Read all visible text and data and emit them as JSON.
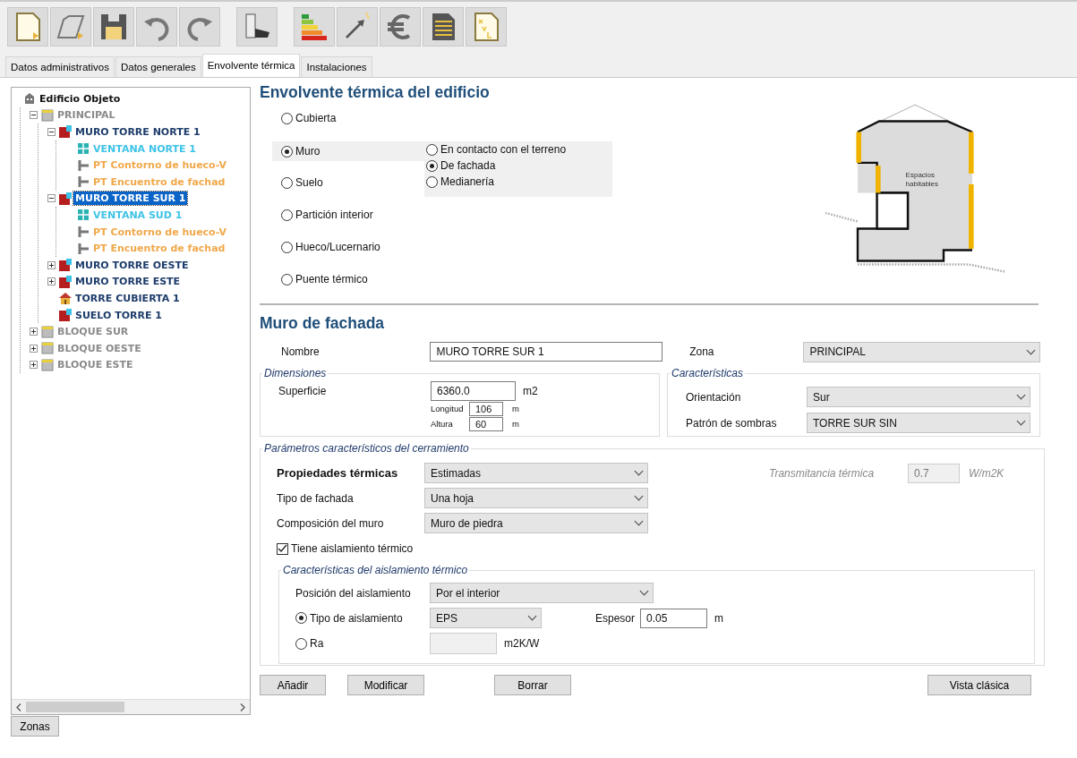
{
  "tabs": [
    {
      "label": "Datos administrativos",
      "selected": false
    },
    {
      "label": "Datos generales",
      "selected": false
    },
    {
      "label": "Envolvente térmica",
      "selected": true
    },
    {
      "label": "Instalaciones",
      "selected": false
    }
  ],
  "tree": {
    "label": "Edificio Objeto",
    "kind": "building",
    "children": [
      {
        "label": "PRINCIPAL",
        "kind": "zone",
        "selected": false,
        "expanded": true,
        "children": [
          {
            "label": "MURO TORRE  NORTE 1",
            "kind": "wall",
            "selected": false,
            "expanded": true,
            "children": [
              {
                "label": "VENTANA NORTE 1",
                "kind": "window",
                "selected": false
              },
              {
                "label": "PT Contorno de hueco-V",
                "kind": "bridge",
                "selected": false
              },
              {
                "label": "PT Encuentro de fachad",
                "kind": "bridge",
                "selected": false
              }
            ]
          },
          {
            "label": "MURO TORRE SUR 1",
            "kind": "wall",
            "selected": true,
            "expanded": true,
            "children": [
              {
                "label": "VENTANA SUD 1",
                "kind": "window",
                "selected": false
              },
              {
                "label": "PT Contorno de hueco-V",
                "kind": "bridge",
                "selected": false
              },
              {
                "label": "PT Encuentro de fachad",
                "kind": "bridge",
                "selected": false
              }
            ]
          },
          {
            "label": "MURO TORRE OESTE",
            "kind": "wall",
            "selected": false,
            "expanded": false
          },
          {
            "label": "MURO TORRE ESTE",
            "kind": "wall",
            "selected": false,
            "expanded": false
          },
          {
            "label": "TORRE CUBIERTA 1",
            "kind": "roof",
            "selected": false
          },
          {
            "label": "SUELO TORRE 1",
            "kind": "wall",
            "selected": false
          }
        ]
      },
      {
        "label": "BLOQUE SUR",
        "kind": "zone",
        "selected": false,
        "expanded": false
      },
      {
        "label": "BLOQUE OESTE",
        "kind": "zone",
        "selected": false,
        "expanded": false
      },
      {
        "label": "BLOQUE ESTE",
        "kind": "zone",
        "selected": false,
        "expanded": false
      }
    ]
  },
  "zones_button": "Zonas",
  "envelope": {
    "title": "Envolvente térmica del edificio",
    "types": [
      {
        "label": "Cubierta",
        "selected": false
      },
      {
        "label": "Muro",
        "selected": true,
        "options": [
          {
            "label": "En contacto con el terreno",
            "selected": false
          },
          {
            "label": "De fachada",
            "selected": true
          },
          {
            "label": "Medianería",
            "selected": false
          }
        ]
      },
      {
        "label": "Suelo",
        "selected": false
      },
      {
        "label": "Partición interior",
        "selected": false
      },
      {
        "label": "Hueco/Lucernario",
        "selected": false
      },
      {
        "label": "Puente térmico",
        "selected": false
      }
    ],
    "diagram_label": [
      "Espacios",
      "habitables"
    ]
  },
  "form": {
    "title": "Muro de fachada",
    "name_label": "Nombre",
    "name_value": "MURO TORRE SUR 1",
    "zone_label": "Zona",
    "zone_value": "PRINCIPAL",
    "dimensions": {
      "legend": "Dimensiones",
      "area_label": "Superficie",
      "area_value": "6360.0",
      "area_unit": "m2",
      "length_label": "Longitud",
      "length_value": "106",
      "length_unit": "m",
      "height_label": "Altura",
      "height_value": "60",
      "height_unit": "m"
    },
    "characteristics": {
      "legend": "Características",
      "orientation_label": "Orientación",
      "orientation_value": "Sur",
      "shadow_label": "Patrón de sombras",
      "shadow_value": "TORRE SUR SIN"
    },
    "parameters": {
      "legend": "Parámetros característicos del cerramiento",
      "thermal_label": "Propiedades térmicas",
      "thermal_value": "Estimadas",
      "transmittance_label": "Transmitancia térmica",
      "transmittance_value": "0.7",
      "transmittance_unit": "W/m2K",
      "facade_label": "Tipo de fachada",
      "facade_value": "Una hoja",
      "composition_label": "Composición del muro",
      "composition_value": "Muro de piedra",
      "insulation_label": "Tiene aislamiento térmico",
      "insulation_checked": true,
      "insulation": {
        "legend": "Características del aislamiento térmico",
        "position_label": "Posición del aislamiento",
        "position_value": "Por el interior",
        "type_label": "Tipo de aislamiento",
        "type_selected": true,
        "type_value": "EPS",
        "thickness_label": "Espesor",
        "thickness_value": "0.05",
        "thickness_unit": "m",
        "ra_label": "Ra",
        "ra_selected": false,
        "ra_unit": "m2K/W"
      }
    }
  },
  "buttons": {
    "add": "Añadir",
    "modify": "Modificar",
    "delete": "Borrar",
    "classic": "Vista clásica"
  }
}
